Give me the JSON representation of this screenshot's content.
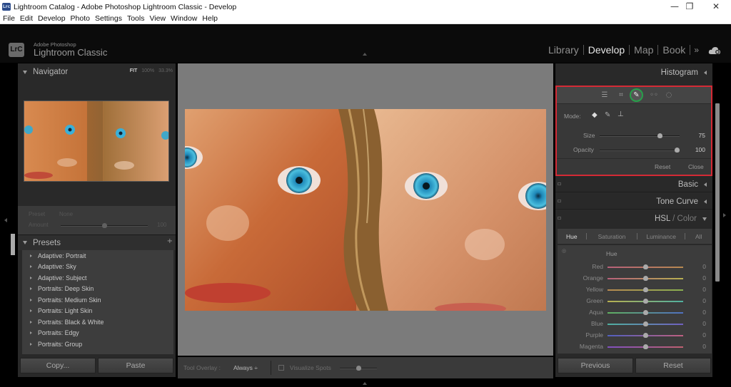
{
  "window": {
    "title": "Lightroom Catalog - Adobe Photoshop Lightroom Classic - Develop",
    "app_icon_text": "Lrc",
    "controls": {
      "minimize": "—",
      "restore": "❐",
      "close": "✕"
    }
  },
  "menu": [
    "File",
    "Edit",
    "Develop",
    "Photo",
    "Settings",
    "Tools",
    "View",
    "Window",
    "Help"
  ],
  "header": {
    "logo_text": "LrC",
    "brand_small": "Adobe Photoshop",
    "brand_big": "Lightroom Classic",
    "modules": [
      {
        "label": "Library",
        "active": false
      },
      {
        "label": "Develop",
        "active": true
      },
      {
        "label": "Map",
        "active": false
      },
      {
        "label": "Book",
        "active": false
      }
    ],
    "more": "»",
    "cloud_icon": "cloud-sync-icon"
  },
  "left_panel": {
    "navigator": {
      "title": "Navigator",
      "zoom_options": [
        "FIT",
        "100%",
        "33.3%"
      ],
      "selected_zoom": "FIT"
    },
    "preset_amount": {
      "preset_label": "Preset",
      "preset_value": "None",
      "amount_label": "Amount",
      "amount_value": "100",
      "amount_fraction": 0.5
    },
    "presets": {
      "title": "Presets",
      "add": "+",
      "items": [
        "Adaptive: Portrait",
        "Adaptive: Sky",
        "Adaptive: Subject",
        "Portraits: Deep Skin",
        "Portraits: Medium Skin",
        "Portraits: Light Skin",
        "Portraits: Black & White",
        "Portraits: Edgy",
        "Portraits: Group"
      ]
    },
    "buttons": {
      "copy": "Copy...",
      "paste": "Paste"
    }
  },
  "toolbar": {
    "tool_overlay_label": "Tool Overlay :",
    "tool_overlay_value": "Always ÷",
    "visualize_spots_label": "Visualize Spots",
    "visualize_spots_checked": false,
    "visualize_threshold_fraction": 0.5
  },
  "right_panel": {
    "histogram": {
      "title": "Histogram"
    },
    "spot_removal": {
      "tools": [
        "edit-sliders",
        "crop",
        "spot-removal",
        "red-eye",
        "masking"
      ],
      "active_tool": "spot-removal",
      "mode_label": "Mode:",
      "modes": [
        "clone",
        "heal",
        "fill"
      ],
      "size_label": "Size",
      "size_value": "75",
      "size_fraction": 0.75,
      "opacity_label": "Opacity",
      "opacity_value": "100",
      "opacity_fraction": 1.0,
      "reset": "Reset",
      "close": "Close",
      "highlight_color": "#d42a35",
      "active_ring_color": "#27a04a"
    },
    "sections": {
      "basic": "Basic",
      "tone_curve": "Tone Curve",
      "hsl_primary": "HSL",
      "hsl_sep": " / ",
      "hsl_secondary": "Color"
    },
    "hsl": {
      "tabs": [
        "Hue",
        "Saturation",
        "Luminance",
        "All"
      ],
      "active_tab": "Hue",
      "group_title": "Hue",
      "rows": [
        {
          "name": "Red",
          "value": "0",
          "from": "#b8607a",
          "to": "#b88a50"
        },
        {
          "name": "Orange",
          "value": "0",
          "from": "#b8607a",
          "to": "#b8b050"
        },
        {
          "name": "Yellow",
          "value": "0",
          "from": "#b88a50",
          "to": "#8ab050"
        },
        {
          "name": "Green",
          "value": "0",
          "from": "#b8b050",
          "to": "#50b0a0"
        },
        {
          "name": "Aqua",
          "value": "0",
          "from": "#60b060",
          "to": "#5070c0"
        },
        {
          "name": "Blue",
          "value": "0",
          "from": "#50b0a0",
          "to": "#7060c0"
        },
        {
          "name": "Purple",
          "value": "0",
          "from": "#5060c0",
          "to": "#c06080"
        },
        {
          "name": "Magenta",
          "value": "0",
          "from": "#8050c0",
          "to": "#c06070"
        }
      ]
    },
    "buttons": {
      "previous": "Previous",
      "reset": "Reset"
    }
  }
}
